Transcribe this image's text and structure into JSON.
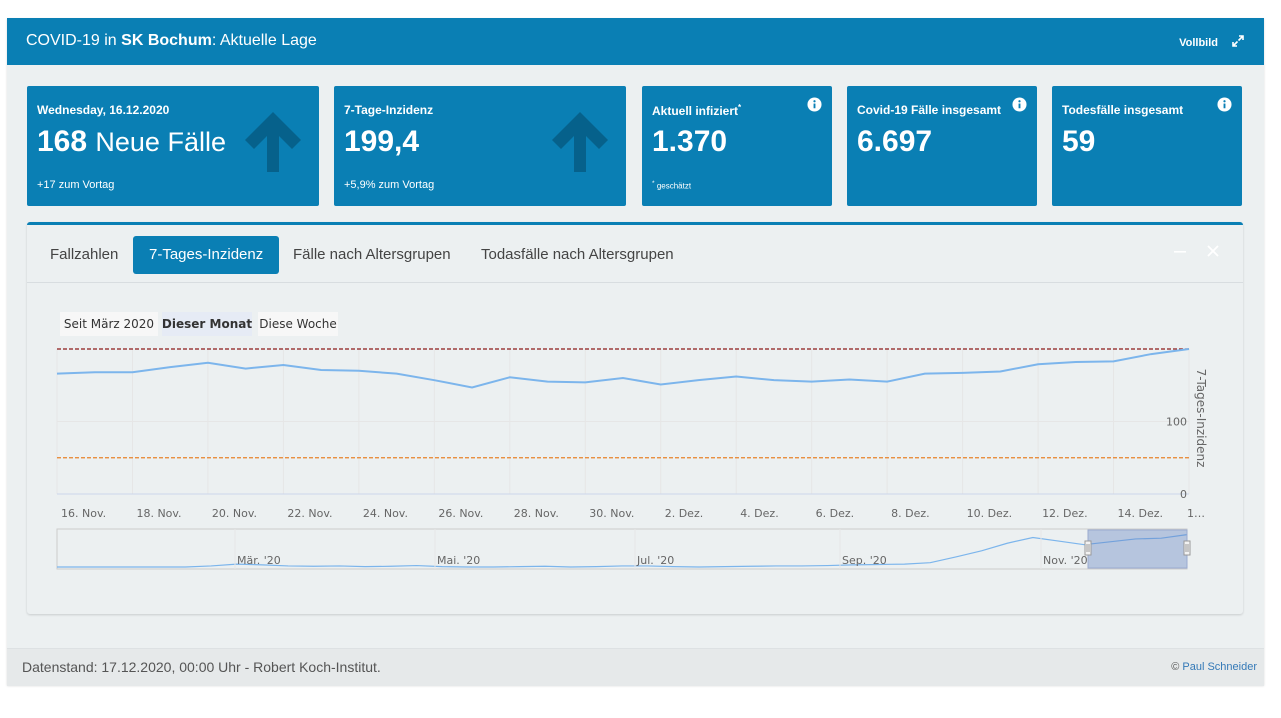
{
  "header": {
    "prefix": "COVID-19 in",
    "region": "SK Bochum",
    "suffix": ": Aktuelle Lage",
    "fullscreen_label": "Vollbild"
  },
  "cards": {
    "new_cases": {
      "label": "Wednesday, 16.12.2020",
      "value": "168",
      "unit": "Neue Fälle",
      "sub": "+17 zum Vortag"
    },
    "incidence": {
      "label": "7-Tage-Inzidenz",
      "value": "199,4",
      "sub": "+5,9% zum Vortag"
    },
    "infected": {
      "label": "Aktuell infiziert",
      "asterisk": "*",
      "value": "1.370",
      "note_mark": "*",
      "note": "geschätzt"
    },
    "total": {
      "label": "Covid-19 Fälle insgesamt",
      "value": "6.697"
    },
    "deaths": {
      "label": "Todesfälle insgesamt",
      "value": "59"
    }
  },
  "tabs": [
    "Fallzahlen",
    "7-Tages-Inzidenz",
    "Fälle nach Altersgrupen",
    "Todasfälle nach Altersgrupen"
  ],
  "active_tab": 1,
  "range_buttons": [
    "Seit März 2020",
    "Dieser Monat",
    "Diese Woche"
  ],
  "active_range": 1,
  "chart_data": {
    "type": "line",
    "title": "",
    "ylabel": "7-Tages-Inzidenz",
    "ylim": [
      0,
      200
    ],
    "yticks": [
      "0",
      "100"
    ],
    "xticks": [
      "16. Nov.",
      "18. Nov.",
      "20. Nov.",
      "22. Nov.",
      "24. Nov.",
      "26. Nov.",
      "28. Nov.",
      "30. Nov.",
      "2. Dez.",
      "4. Dez.",
      "6. Dez.",
      "8. Dez.",
      "10. Dez.",
      "12. Dez.",
      "14. Dez.",
      "1…"
    ],
    "x": [
      "2020-11-16",
      "2020-11-17",
      "2020-11-18",
      "2020-11-19",
      "2020-11-20",
      "2020-11-21",
      "2020-11-22",
      "2020-11-23",
      "2020-11-24",
      "2020-11-25",
      "2020-11-26",
      "2020-11-27",
      "2020-11-28",
      "2020-11-29",
      "2020-11-30",
      "2020-12-01",
      "2020-12-02",
      "2020-12-03",
      "2020-12-04",
      "2020-12-05",
      "2020-12-06",
      "2020-12-07",
      "2020-12-08",
      "2020-12-09",
      "2020-12-10",
      "2020-12-11",
      "2020-12-12",
      "2020-12-13",
      "2020-12-14",
      "2020-12-15",
      "2020-12-16"
    ],
    "series": [
      {
        "values": [
          166,
          168,
          168,
          175,
          181,
          173,
          178,
          171,
          170,
          166,
          157,
          147,
          161,
          155,
          154,
          160,
          151,
          157,
          162,
          157,
          155,
          158,
          155,
          166,
          167,
          169,
          179,
          182,
          183,
          193,
          200
        ]
      }
    ],
    "threshold_lines": [
      {
        "value": 200,
        "color": "#8b1a1a"
      },
      {
        "value": 50,
        "color": "#e8822a"
      }
    ],
    "navigator_xticks": [
      "Mär. '20",
      "Mai. '20",
      "Jul. '20",
      "Sep. '20",
      "Nov. '20"
    ],
    "line_color": "#7cb5ec"
  },
  "footer": {
    "stand": "Datenstand: 17.12.2020, 00:00 Uhr - Robert Koch-Institut.",
    "copyright_symbol": "©",
    "author": "Paul Schneider"
  },
  "colors": {
    "brand": "#0a7fb4",
    "panel": "#ecf0f1"
  }
}
